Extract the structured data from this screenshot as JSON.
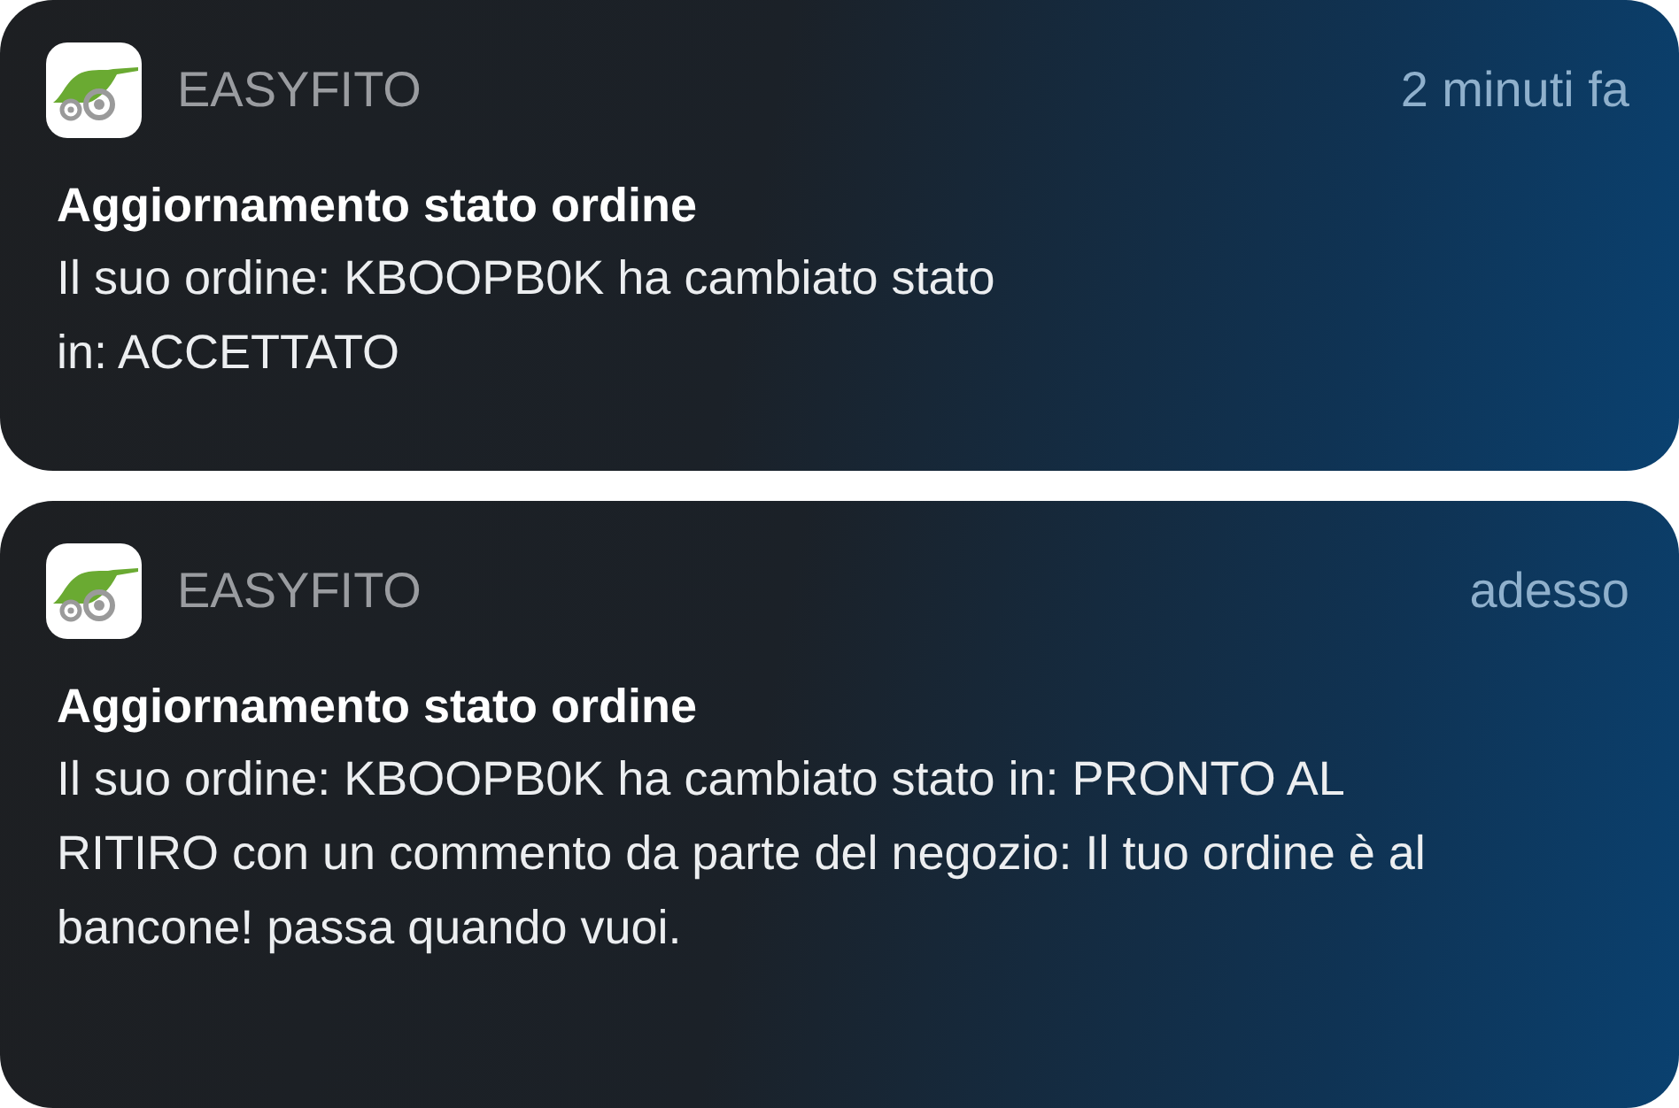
{
  "notifications": [
    {
      "app": "EASYFITO",
      "time": "2 minuti fa",
      "title": "Aggiornamento stato ordine",
      "body": "Il suo ordine: KBOOPB0K ha cambiato stato\nin: ACCETTATO"
    },
    {
      "app": "EASYFITO",
      "time": "adesso",
      "title": "Aggiornamento stato ordine",
      "body": "Il suo ordine: KBOOPB0K ha cambiato stato in: PRONTO AL RITIRO con un commento da parte del negozio: Il tuo ordine è al bancone! passa quando vuoi."
    }
  ]
}
